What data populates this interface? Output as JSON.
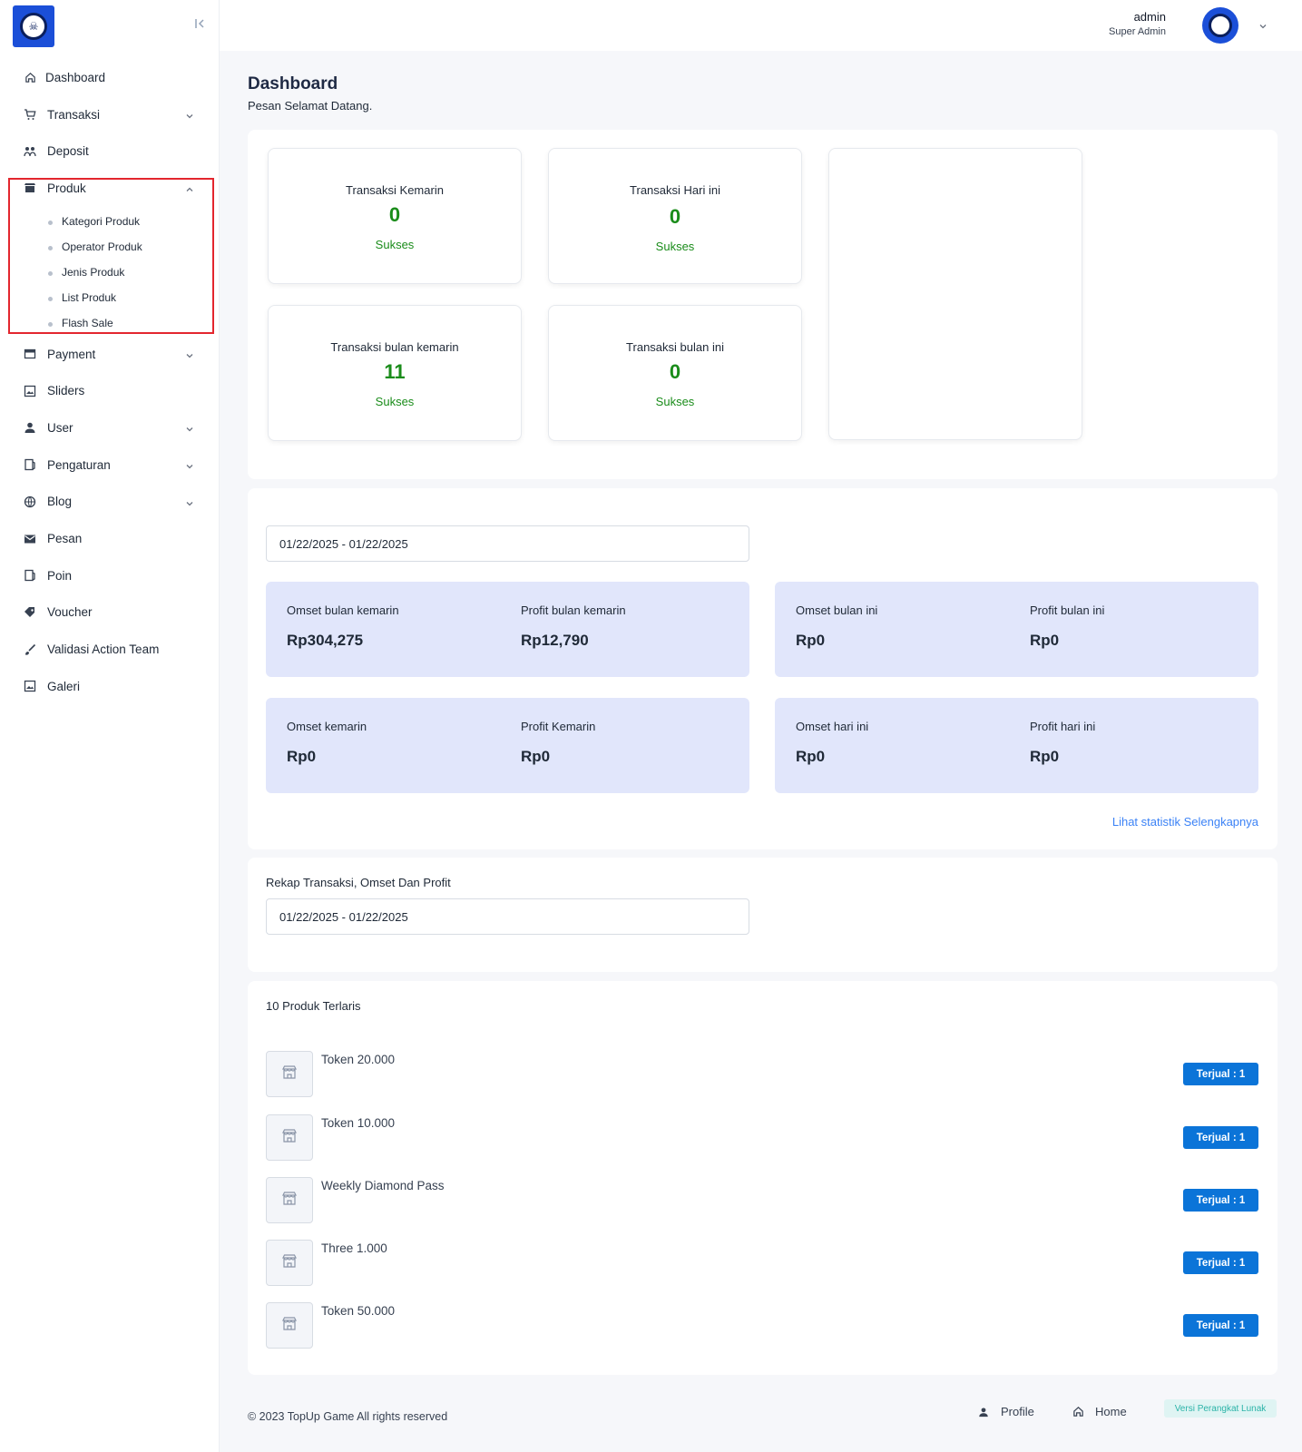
{
  "sidebar": {
    "items": [
      {
        "label": "Dashboard",
        "icon": "home-icon"
      },
      {
        "label": "Transaksi",
        "icon": "cart-icon"
      },
      {
        "label": "Deposit",
        "icon": "deposit-icon"
      },
      {
        "label": "Produk",
        "icon": "store-icon"
      },
      {
        "label": "Payment",
        "icon": "payment-icon"
      },
      {
        "label": "Sliders",
        "icon": "image-icon"
      },
      {
        "label": "User",
        "icon": "user-icon"
      },
      {
        "label": "Pengaturan",
        "icon": "settings-icon"
      },
      {
        "label": "Blog",
        "icon": "globe-icon"
      },
      {
        "label": "Pesan",
        "icon": "mail-icon"
      },
      {
        "label": "Poin",
        "icon": "points-icon"
      },
      {
        "label": "Voucher",
        "icon": "voucher-icon"
      },
      {
        "label": "Validasi Action Team",
        "icon": "brush-icon"
      },
      {
        "label": "Galeri",
        "icon": "gallery-icon"
      }
    ],
    "produk_sub": [
      "Kategori Produk",
      "Operator Produk",
      "Jenis Produk",
      "List Produk",
      "Flash Sale"
    ]
  },
  "header": {
    "user_name": "admin",
    "user_role": "Super Admin"
  },
  "page": {
    "title": "Dashboard",
    "subtitle": "Pesan Selamat Datang."
  },
  "stats": [
    {
      "title": "Transaksi Kemarin",
      "value": "0",
      "status": "Sukses"
    },
    {
      "title": "Transaksi Hari ini",
      "value": "0",
      "status": "Sukses"
    },
    {
      "title": "Transaksi bulan kemarin",
      "value": "11",
      "status": "Sukses"
    },
    {
      "title": "Transaksi bulan ini",
      "value": "0",
      "status": "Sukses"
    }
  ],
  "finance": {
    "date_range": "01/22/2025 - 01/22/2025",
    "boxes": [
      {
        "l1": "Omset bulan kemarin",
        "v1": "Rp304,275",
        "l2": "Profit bulan kemarin",
        "v2": "Rp12,790"
      },
      {
        "l1": "Omset bulan ini",
        "v1": "Rp0",
        "l2": "Profit bulan ini",
        "v2": "Rp0"
      },
      {
        "l1": "Omset kemarin",
        "v1": "Rp0",
        "l2": "Profit Kemarin",
        "v2": "Rp0"
      },
      {
        "l1": "Omset hari ini",
        "v1": "Rp0",
        "l2": "Profit hari ini",
        "v2": "Rp0"
      }
    ],
    "more_link": "Lihat statistik Selengkapnya"
  },
  "rekap": {
    "title": "Rekap Transaksi, Omset Dan Profit",
    "date_range": "01/22/2025 - 01/22/2025"
  },
  "top_products": {
    "title": "10 Produk Terlaris",
    "items": [
      {
        "name": "Token 20.000",
        "badge": "Terjual : 1"
      },
      {
        "name": "Token 10.000",
        "badge": "Terjual : 1"
      },
      {
        "name": "Weekly Diamond Pass",
        "badge": "Terjual : 1"
      },
      {
        "name": "Three 1.000",
        "badge": "Terjual : 1"
      },
      {
        "name": "Token 50.000",
        "badge": "Terjual : 1"
      }
    ]
  },
  "footer": {
    "copyright": "© 2023 TopUp Game All rights reserved",
    "profile": "Profile",
    "home": "Home",
    "version": "Versi Perangkat Lunak"
  },
  "colors": {
    "accent": "#0b74d8",
    "success": "#1a8c1a",
    "finance_bg": "#e1e6fb",
    "highlight_border": "#e3262e"
  }
}
